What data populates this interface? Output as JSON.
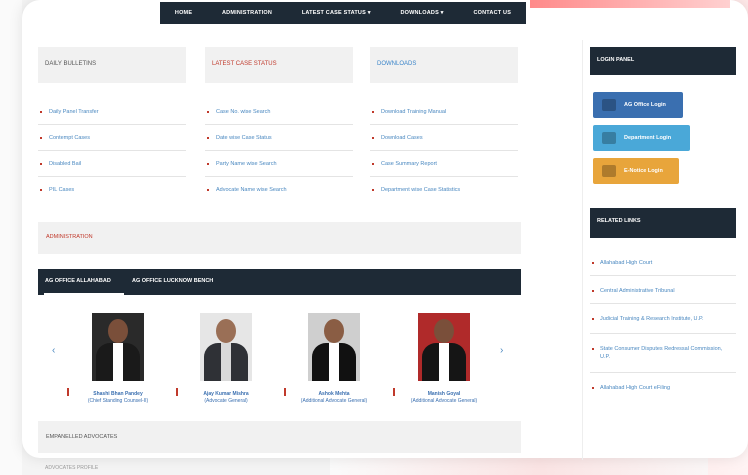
{
  "nav": {
    "items": [
      "HOME",
      "ADMINISTRATION",
      "LATEST CASE STATUS",
      "DOWNLOADS",
      "CONTACT US"
    ]
  },
  "columns": [
    {
      "title": "DAILY BULLETINS",
      "color": "gray",
      "links": [
        "Daily Panel Transfer",
        "Contempt Cases",
        "Disabled Bail",
        "PIL Cases"
      ]
    },
    {
      "title": "LATEST CASE STATUS",
      "color": "red",
      "links": [
        "Case No. wise Search",
        "Date wise Case Status",
        "Party Name wise Search",
        "Advocate Name wise Search"
      ]
    },
    {
      "title": "DOWNLOADS",
      "color": "blue",
      "links": [
        "Download Training Manual",
        "Download Cases",
        "Case Summary Report",
        "Department wise Case Statistics"
      ]
    }
  ],
  "admin_notification": "ADMINISTRATION",
  "tabs": [
    "AG OFFICE ALLAHABAD",
    "AG OFFICE LUCKNOW BENCH"
  ],
  "people": [
    {
      "name": "Shashi Bhan Pandey",
      "role": "(Chief Standing Counsel-II)"
    },
    {
      "name": "Ajay Kumar Mishra",
      "role": "(Advocate General)"
    },
    {
      "name": "Ashok Mehta",
      "role": "(Additional Advocate General)"
    },
    {
      "name": "Manish Goyal",
      "role": "(Additional Advocate General)"
    }
  ],
  "services_title": "EMPANELLED ADVOCATES",
  "services_sub": "ADVOCATES PROFILE",
  "login_panel": {
    "title": "LOGIN PANEL",
    "buttons": [
      {
        "label": "AG Office Login",
        "color": "#3a6fb0"
      },
      {
        "label": "Department Login",
        "color": "#4aa8d8"
      },
      {
        "label": "E-Notice Login",
        "color": "#e8a53b"
      }
    ]
  },
  "related": {
    "title": "RELATED LINKS",
    "links": [
      "Allahabad High Court",
      "Central Administrative Tribunal",
      "Judicial Training & Research Institute, U.P.",
      "State Consumer Disputes Redressal Commission, U.P.",
      "Allahabad High Court eFiling"
    ]
  }
}
